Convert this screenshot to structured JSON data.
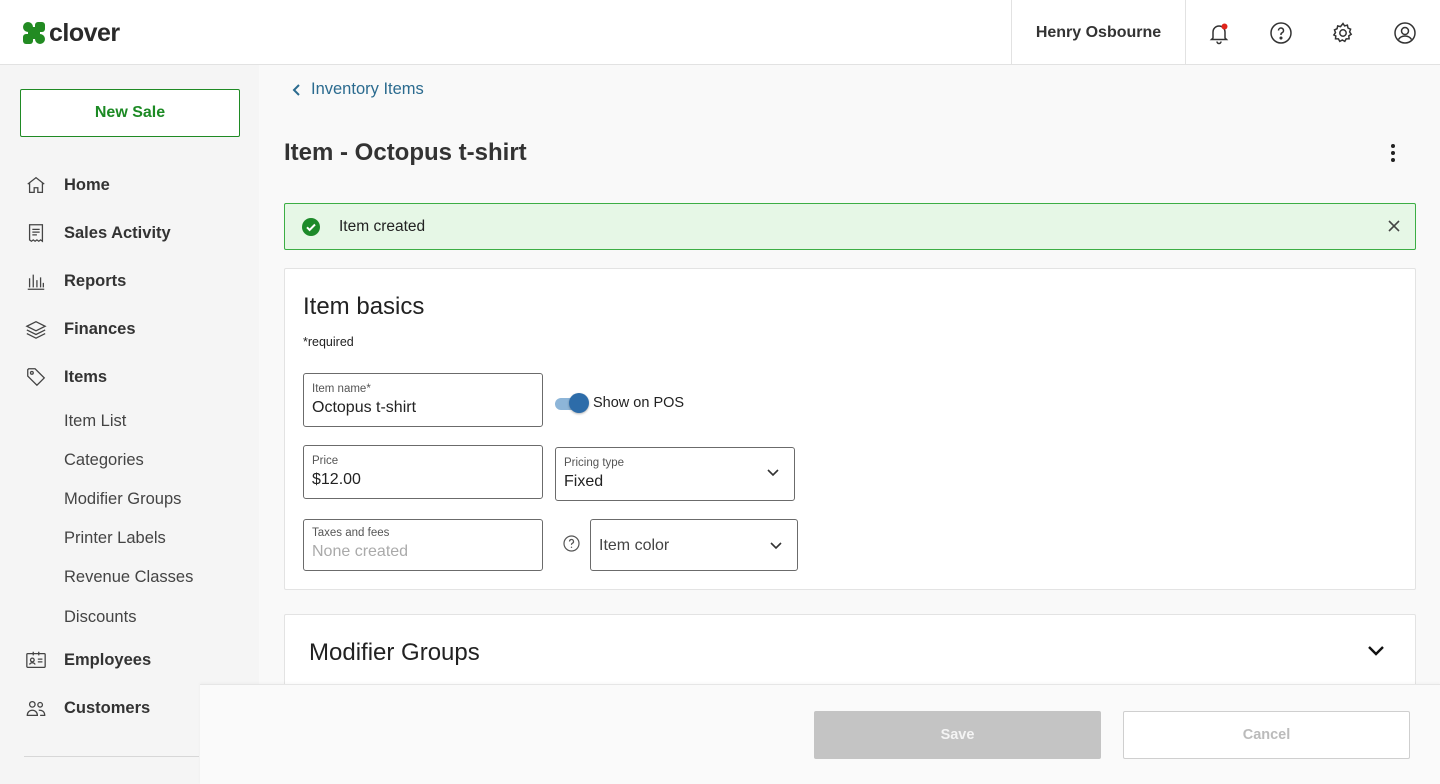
{
  "header": {
    "logo_text": "clover",
    "user_name": "Henry Osbourne",
    "icons": [
      "bell-icon",
      "help-icon",
      "gear-icon",
      "account-icon"
    ],
    "notification_dot_color": "#e0241b"
  },
  "sidebar": {
    "new_sale_label": "New Sale",
    "items": [
      {
        "label": "Home",
        "icon": "home-icon"
      },
      {
        "label": "Sales Activity",
        "icon": "receipt-icon"
      },
      {
        "label": "Reports",
        "icon": "bar-chart-icon"
      },
      {
        "label": "Finances",
        "icon": "money-stack-icon"
      },
      {
        "label": "Items",
        "icon": "tag-icon"
      }
    ],
    "sub_items": [
      "Item List",
      "Categories",
      "Modifier Groups",
      "Printer Labels",
      "Revenue Classes",
      "Discounts"
    ],
    "bottom_items": [
      {
        "label": "Employees",
        "icon": "id-card-icon"
      },
      {
        "label": "Customers",
        "icon": "people-icon"
      }
    ]
  },
  "main": {
    "breadcrumb": "Inventory Items",
    "title": "Item - Octopus t-shirt",
    "alert": {
      "message": "Item created"
    },
    "item_basics": {
      "heading": "Item basics",
      "required_note": "*required",
      "item_name": {
        "label": "Item name*",
        "value": "Octopus t-shirt"
      },
      "show_on_pos": {
        "label": "Show on POS",
        "enabled": true
      },
      "price": {
        "label": "Price",
        "value": "$12.00"
      },
      "pricing_type": {
        "label": "Pricing type",
        "value": "Fixed"
      },
      "taxes": {
        "label": "Taxes and fees",
        "value": "None created"
      },
      "item_color": {
        "value": "Item color"
      }
    },
    "modifier_groups": {
      "heading": "Modifier Groups"
    }
  },
  "footer": {
    "save_label": "Save",
    "cancel_label": "Cancel"
  },
  "colors": {
    "brand_green": "#1c8a24",
    "alert_bg": "#e6f7e6",
    "link_blue": "#2b6b8f",
    "toggle_blue": "#2d6ca9"
  }
}
